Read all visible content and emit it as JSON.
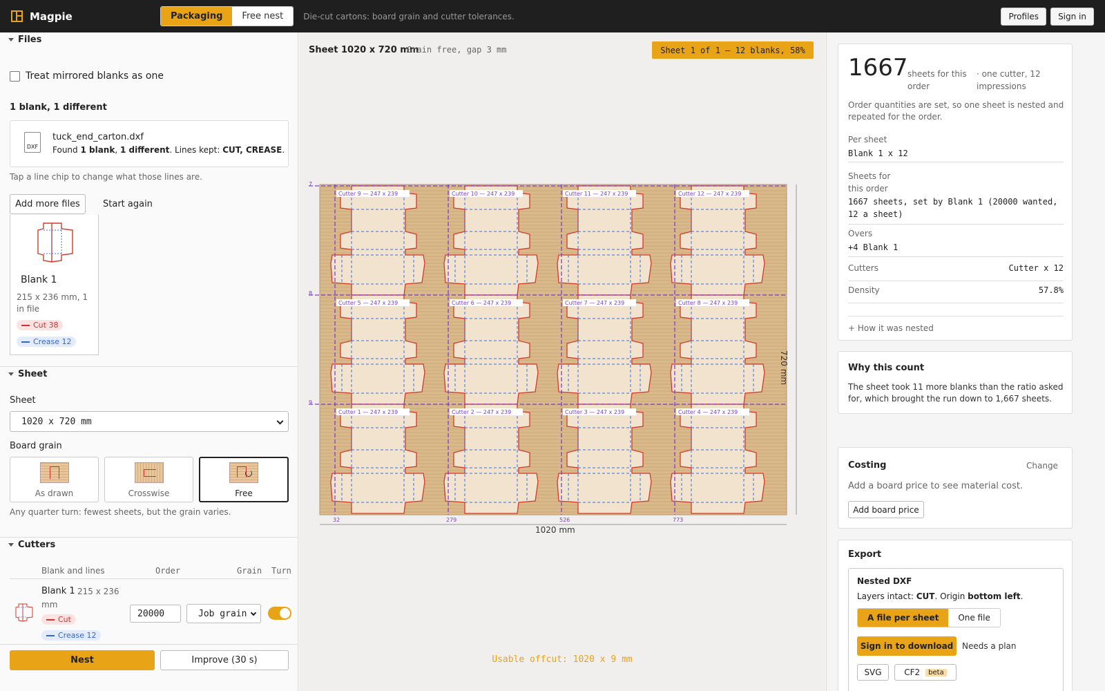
{
  "header": {
    "app_name": "Magpie",
    "modes": [
      "Packaging",
      "Free nest"
    ],
    "active_mode": "Packaging",
    "tagline": "Die-cut cartons: board grain and cutter tolerances.",
    "profiles_label": "Profiles",
    "sign_in_label": "Sign in"
  },
  "files": {
    "section_title": "Files",
    "mirror_label": "Treat mirrored blanks as one",
    "mirror_checked": false,
    "summary": "1 blank, 1 different",
    "file_name": "tuck_end_carton.dxf",
    "file_icon_label": "DXF",
    "found_prefix": "Found ",
    "found_blank": "1 blank",
    "found_sep": ", ",
    "found_diff": "1 different",
    "found_mid": ". Lines kept: ",
    "found_lines": "CUT, CREASE",
    "found_end": ".",
    "hint": "Tap a line chip to change what those lines are.",
    "add_more_label": "Add more files",
    "start_again_label": "Start again",
    "blank": {
      "name": "Blank 1",
      "dims": "215 x 236 mm, 1 in file",
      "cut_chip": "Cut 38",
      "crease_chip": "Crease 12"
    }
  },
  "sheet_section": {
    "section_title": "Sheet",
    "sheet_label": "Sheet",
    "sheet_value": "1020 x 720 mm",
    "grain_label": "Board grain",
    "grain_options": [
      "As drawn",
      "Crosswise",
      "Free"
    ],
    "grain_selected": "Free",
    "grain_hint": "Any quarter turn: fewest sheets, but the grain varies."
  },
  "cutters": {
    "section_title": "Cutters",
    "headers": [
      "Blank and lines",
      "Order",
      "Grain",
      "Turn"
    ],
    "rows": [
      {
        "name": "Blank 1",
        "dims": "215 x 236",
        "unit": "mm",
        "cut": "Cut",
        "crease": "Crease 12",
        "order": "20000",
        "grain": "Job grain",
        "turn": true
      }
    ],
    "nest_label": "Nest",
    "improve_label": "Improve (30 s)"
  },
  "canvas": {
    "sheet_title": "Sheet 1020 x 720 mm",
    "sheet_meta": "Grain free, gap 3 mm",
    "sheet_badge": "Sheet 1 of 1 — 12 blanks, 58%",
    "width_label": "1020 mm",
    "height_label": "720 mm",
    "x_ticks": [
      "32",
      "279",
      "526",
      "773"
    ],
    "y_ticks": [
      "7",
      "8",
      "9"
    ],
    "cutter_labels": [
      [
        "Cutter 9 — 247 x 239",
        "Cutter 10 — 247 x 239",
        "Cutter 11 — 247 x 239",
        "Cutter 12 — 247 x 239"
      ],
      [
        "Cutter 5 — 247 x 239",
        "Cutter 6 — 247 x 239",
        "Cutter 7 — 247 x 239",
        "Cutter 8 — 247 x 239"
      ],
      [
        "Cutter 1 — 247 x 239",
        "Cutter 2 — 247 x 239",
        "Cutter 3 — 247 x 239",
        "Cutter 4 — 247 x 239"
      ]
    ],
    "offcut": "Usable offcut: 1020 x 9 mm",
    "colors": {
      "board": "#d9b88a",
      "cut": "#d23a2a",
      "crease": "#3a6fd8",
      "guide": "#7b3fd0",
      "accent": "#e8a317"
    }
  },
  "summary": {
    "sheets_count": "1667",
    "sheets_label": "sheets for this order",
    "cutter_note": "· one cutter, 12 impressions",
    "desc": "Order quantities are set, so one sheet is nested and repeated for the order.",
    "per_sheet_label": "Per sheet",
    "per_sheet_value": "Blank 1 x 12",
    "sheets_order_label": "Sheets for this order",
    "sheets_order_value": "1667 sheets, set by Blank 1 (20000 wanted, 12 a sheet)",
    "overs_label": "Overs",
    "overs_value": "+4 Blank 1",
    "cutters_label": "Cutters",
    "cutters_value": "Cutter x 12",
    "density_label": "Density",
    "density_value": "57.8%",
    "how_label": "+ How it was nested"
  },
  "why": {
    "title": "Why this count",
    "text": "The sheet took 11 more blanks than the ratio asked for, which brought the run down to 1,667 sheets."
  },
  "costing": {
    "title": "Costing",
    "change_label": "Change",
    "hint": "Add a board price to see material cost.",
    "add_label": "Add board price"
  },
  "export": {
    "title": "Export",
    "dxf_title": "Nested DXF",
    "layers_prefix": "Layers intact: ",
    "layers_cut": "CUT",
    "layers_mid": ". Origin ",
    "layers_origin": "bottom left",
    "layers_end": ".",
    "file_modes": [
      "A file per sheet",
      "One file"
    ],
    "file_mode_selected": "A file per sheet",
    "download_label": "Sign in to download",
    "plan_note": "Needs a plan",
    "formats": [
      "SVG",
      "CF2"
    ],
    "beta_label": "beta"
  }
}
